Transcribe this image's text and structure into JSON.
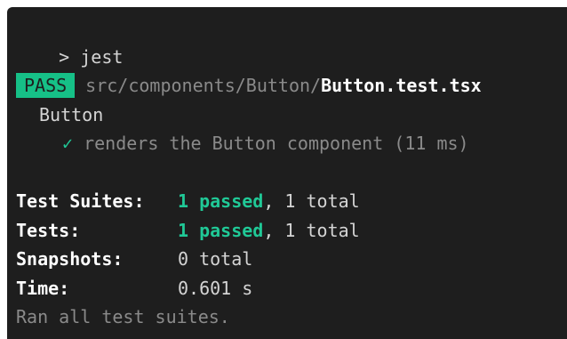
{
  "terminal": {
    "prompt_symbol": ">",
    "command": "jest",
    "pass_badge": "PASS",
    "test_path_dir": "src/components/Button/",
    "test_file": "Button.test.tsx",
    "describe_block": "Button",
    "check_icon": "✓",
    "test_name": "renders the Button component (11 ms)",
    "summary": {
      "suites_label": "Test Suites:",
      "suites_passed": "1 passed",
      "suites_total": ", 1 total",
      "tests_label": "Tests:",
      "tests_passed": "1 passed",
      "tests_total": ", 1 total",
      "snapshots_label": "Snapshots:",
      "snapshots_value": "0 total",
      "time_label": "Time:",
      "time_value": "0.601 s"
    },
    "footer": "Ran all test suites."
  }
}
